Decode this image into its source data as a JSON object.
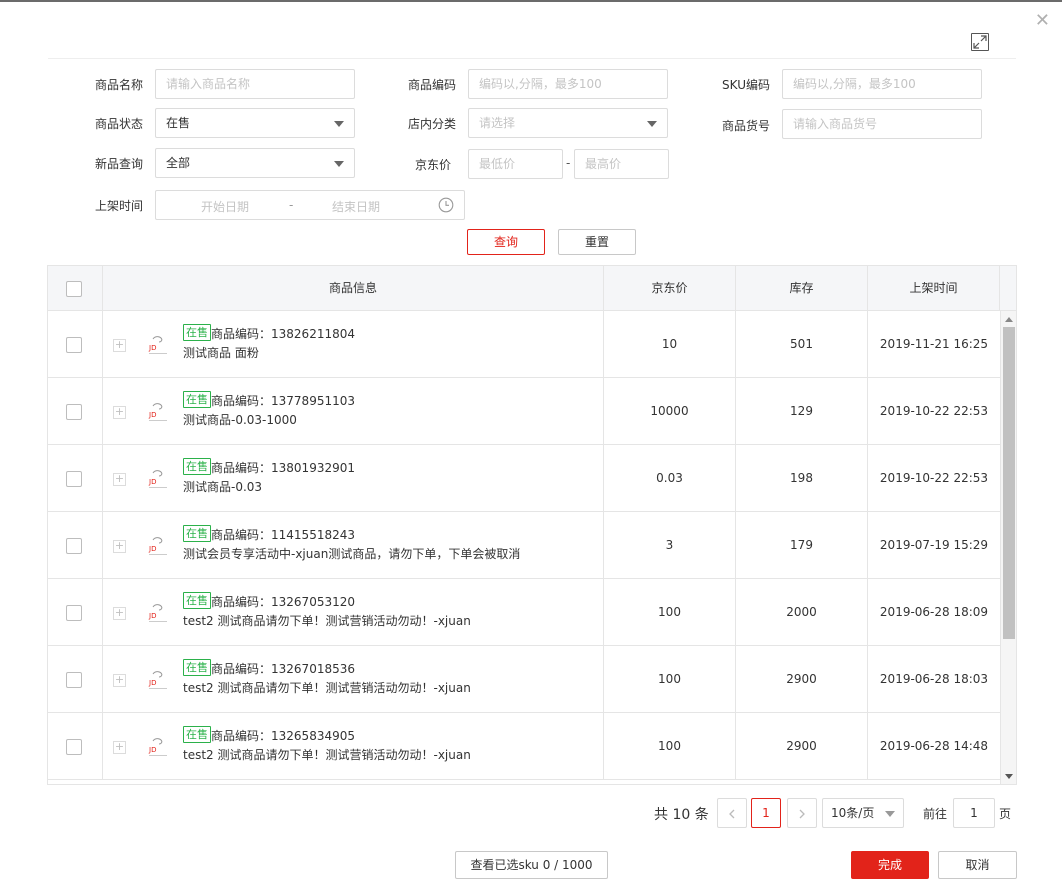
{
  "filters": {
    "name_label": "商品名称",
    "name_ph": "请输入商品名称",
    "code_label": "商品编码",
    "code_ph": "编码以,分隔，最多100",
    "sku_label": "SKU编码",
    "sku_ph": "编码以,分隔，最多100",
    "status_label": "商品状态",
    "status_value": "在售",
    "category_label": "店内分类",
    "category_ph": "请选择",
    "itemno_label": "商品货号",
    "itemno_ph": "请输入商品货号",
    "new_label": "新品查询",
    "new_value": "全部",
    "price_label": "京东价",
    "price_min_ph": "最低价",
    "price_max_ph": "最高价",
    "price_dash": "-",
    "date_label": "上架时间",
    "date_start_ph": "开始日期",
    "date_end_ph": "结束日期",
    "date_dash": "-"
  },
  "actions": {
    "query": "查询",
    "reset": "重置"
  },
  "table": {
    "headers": {
      "info": "商品信息",
      "price": "京东价",
      "stock": "库存",
      "time": "上架时间"
    },
    "status_badge": "在售",
    "code_prefix": "商品编码：",
    "rows": [
      {
        "code": "13826211804",
        "name": "测试商品 面粉",
        "price": "10",
        "stock": "501",
        "time": "2019-11-21 16:25"
      },
      {
        "code": "13778951103",
        "name": "测试商品-0.03-1000",
        "price": "10000",
        "stock": "129",
        "time": "2019-10-22 22:53"
      },
      {
        "code": "13801932901",
        "name": "测试商品-0.03",
        "price": "0.03",
        "stock": "198",
        "time": "2019-10-22 22:53"
      },
      {
        "code": "11415518243",
        "name": "测试会员专享活动中-xjuan测试商品，请勿下单，下单会被取消",
        "price": "3",
        "stock": "179",
        "time": "2019-07-19 15:29"
      },
      {
        "code": "13267053120",
        "name": "test2 测试商品请勿下单！测试营销活动勿动！-xjuan",
        "price": "100",
        "stock": "2000",
        "time": "2019-06-28 18:09"
      },
      {
        "code": "13267018536",
        "name": "test2 测试商品请勿下单！测试营销活动勿动！-xjuan",
        "price": "100",
        "stock": "2900",
        "time": "2019-06-28 18:03"
      },
      {
        "code": "13265834905",
        "name": "test2 测试商品请勿下单！测试营销活动勿动！-xjuan",
        "price": "100",
        "stock": "2900",
        "time": "2019-06-28 14:48"
      }
    ]
  },
  "pagination": {
    "total": "共 10 条",
    "current_page": "1",
    "page_size": "10条/页",
    "goto_label": "前往",
    "goto_value": "1",
    "page_unit": "页"
  },
  "footer": {
    "view_selected": "查看已选sku 0 / 1000",
    "done": "完成",
    "cancel": "取消"
  },
  "colors": {
    "accent": "#e2231a",
    "status_green": "#2bb14a"
  }
}
